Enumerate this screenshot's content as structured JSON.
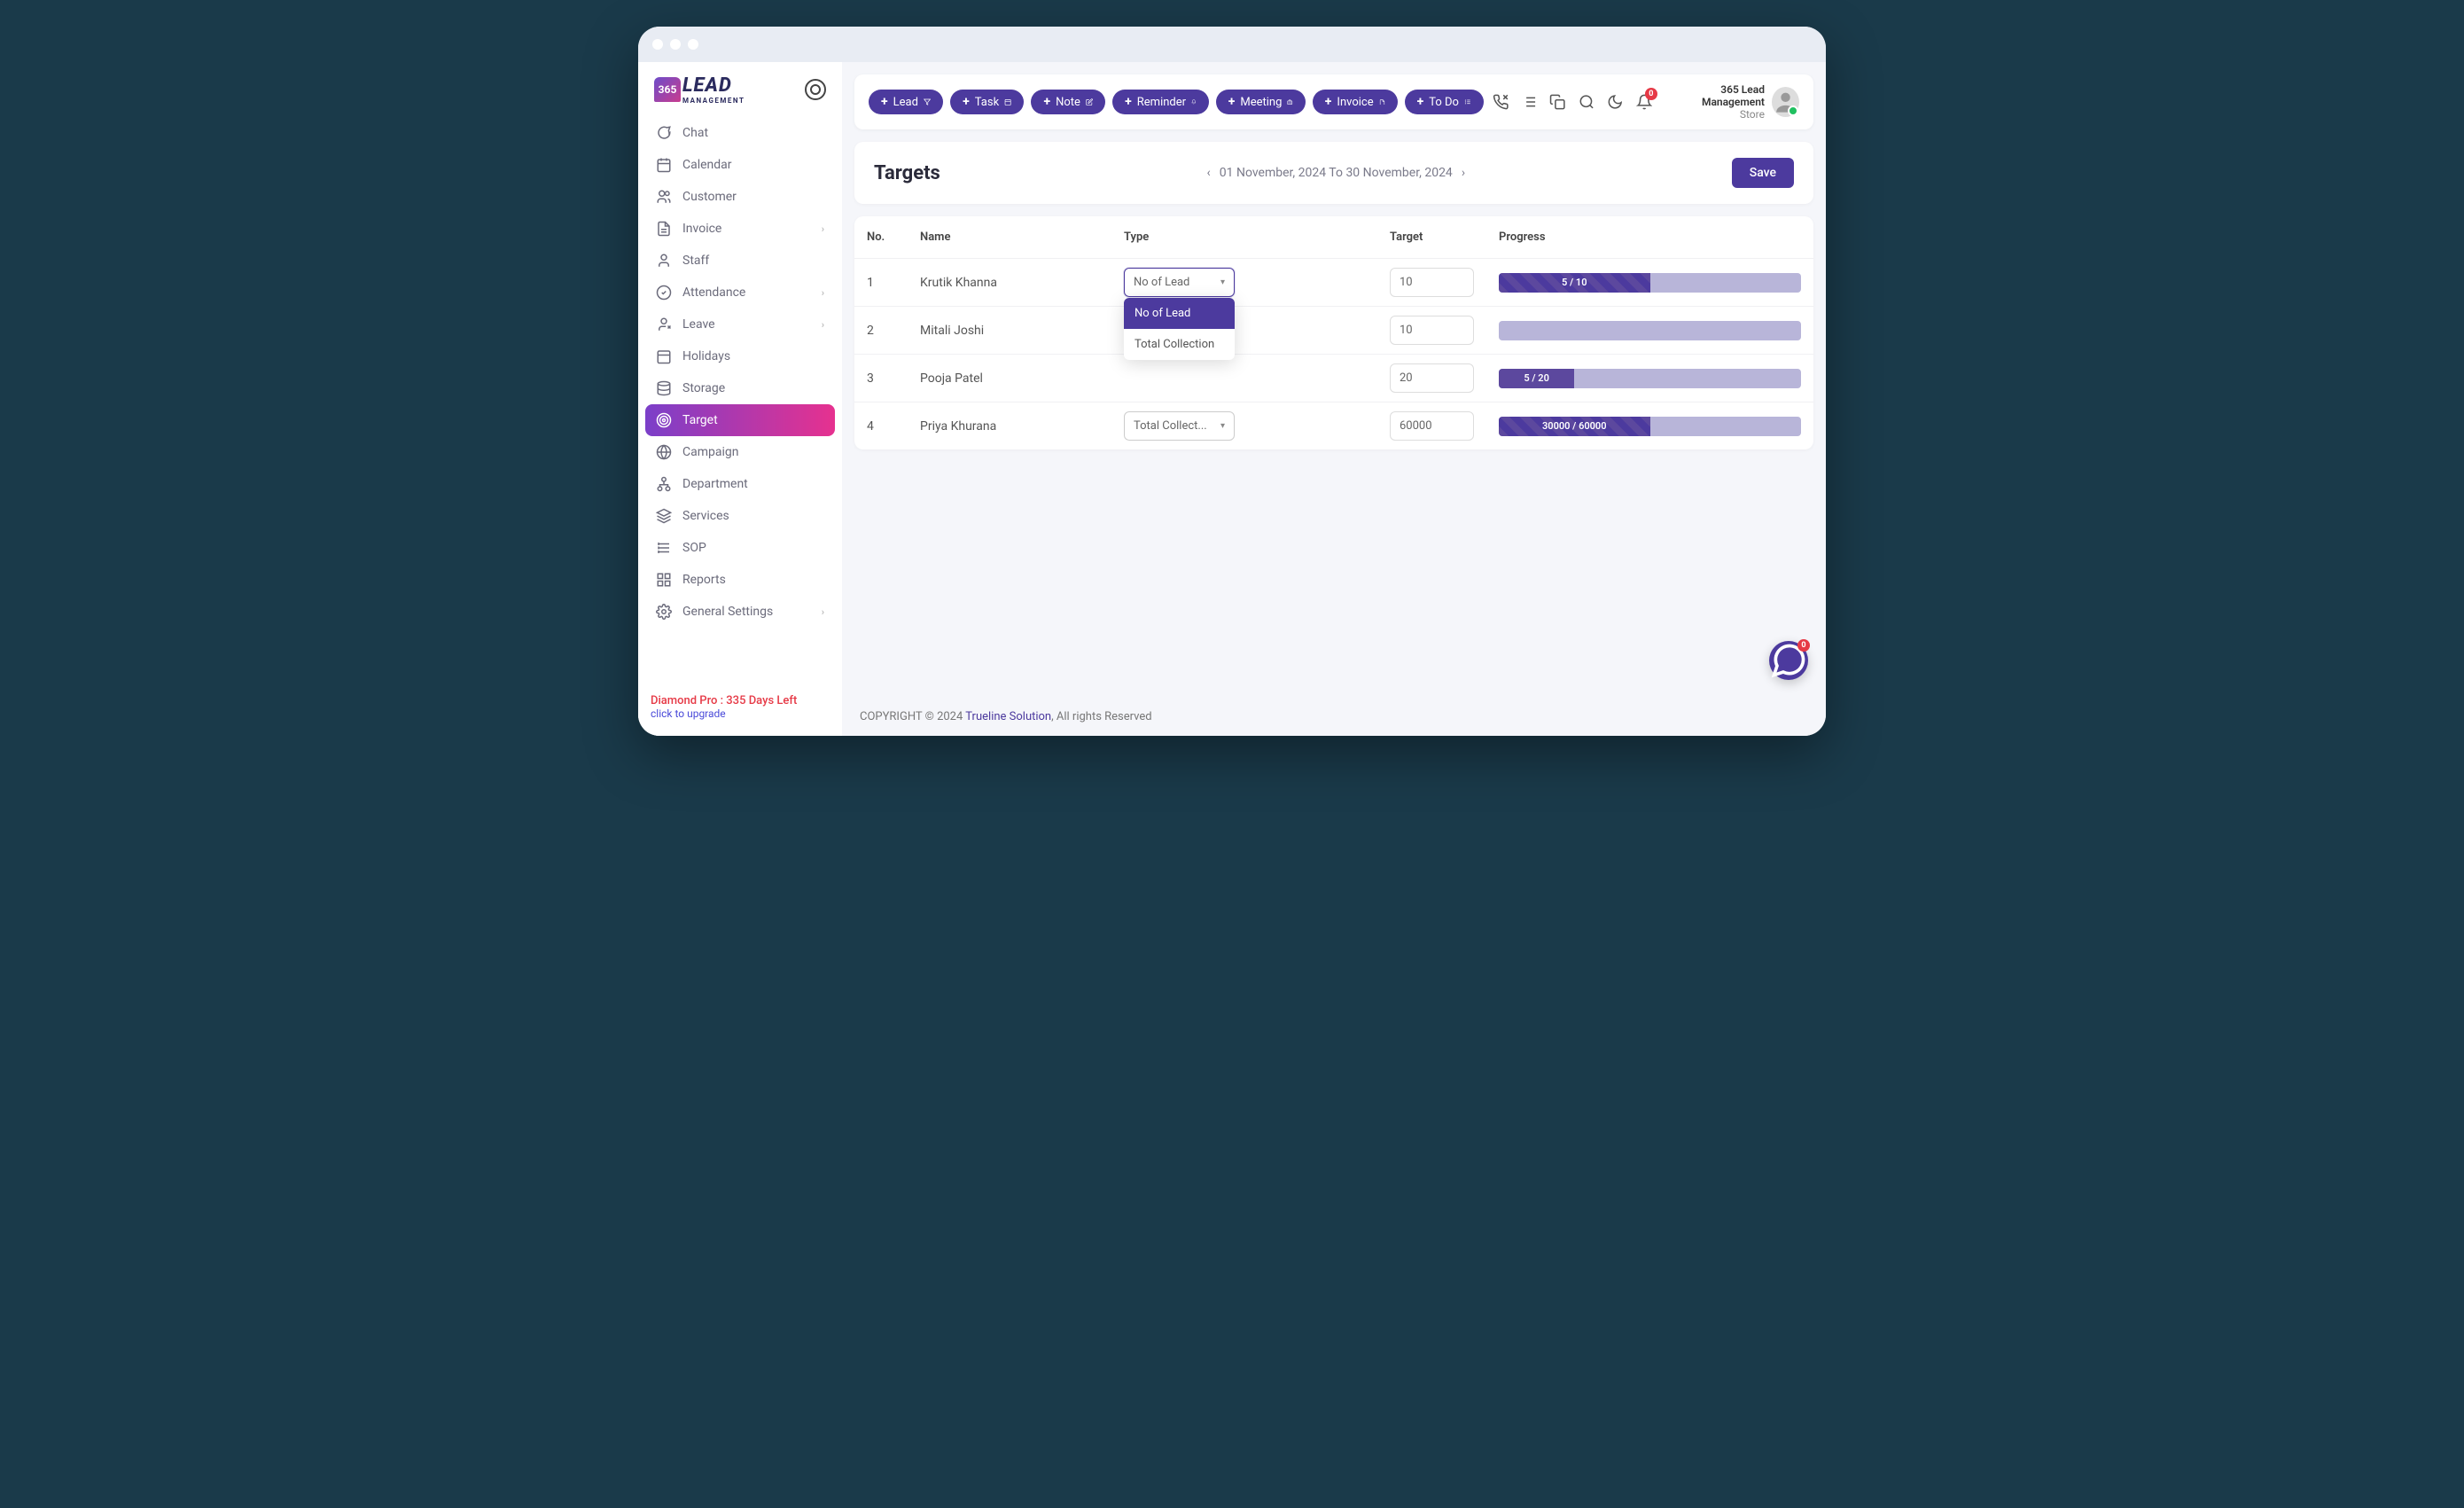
{
  "brand": {
    "name": "LEAD",
    "sub": "MANAGEMENT",
    "mark": "365"
  },
  "sidebar": {
    "items": [
      {
        "label": "Chat",
        "icon": "chat"
      },
      {
        "label": "Calendar",
        "icon": "calendar"
      },
      {
        "label": "Customer",
        "icon": "customer"
      },
      {
        "label": "Invoice",
        "icon": "invoice",
        "expand": true
      },
      {
        "label": "Staff",
        "icon": "staff"
      },
      {
        "label": "Attendance",
        "icon": "attendance",
        "expand": true
      },
      {
        "label": "Leave",
        "icon": "leave",
        "expand": true
      },
      {
        "label": "Holidays",
        "icon": "holidays"
      },
      {
        "label": "Storage",
        "icon": "storage"
      },
      {
        "label": "Target",
        "icon": "target",
        "active": true
      },
      {
        "label": "Campaign",
        "icon": "campaign"
      },
      {
        "label": "Department",
        "icon": "department"
      },
      {
        "label": "Services",
        "icon": "services"
      },
      {
        "label": "SOP",
        "icon": "sop"
      },
      {
        "label": "Reports",
        "icon": "reports"
      },
      {
        "label": "General Settings",
        "icon": "settings",
        "expand": true
      }
    ],
    "plan": "Diamond Pro : 335 Days Left",
    "upgrade": "click to upgrade"
  },
  "toolbar": {
    "buttons": [
      {
        "label": "Lead",
        "icon": "filter"
      },
      {
        "label": "Task",
        "icon": "calendar-small"
      },
      {
        "label": "Note",
        "icon": "edit"
      },
      {
        "label": "Reminder",
        "icon": "bell"
      },
      {
        "label": "Meeting",
        "icon": "briefcase"
      },
      {
        "label": "Invoice",
        "icon": "doc"
      },
      {
        "label": "To Do",
        "icon": "checklist"
      }
    ]
  },
  "header_icons": {
    "bell_count": "0"
  },
  "user": {
    "name": "365 Lead Management",
    "role": "Store"
  },
  "page": {
    "title": "Targets",
    "date_range": "01 November, 2024 To 30 November, 2024",
    "save_label": "Save"
  },
  "table": {
    "headers": {
      "no": "No.",
      "name": "Name",
      "type": "Type",
      "target": "Target",
      "progress": "Progress"
    },
    "type_options": [
      "No of Lead",
      "Total Collection"
    ],
    "rows": [
      {
        "no": "1",
        "name": "Krutik Khanna",
        "type": "No of Lead",
        "target": "10",
        "progress_label": "5 / 10",
        "progress_pct": 50,
        "focused": true,
        "striped": true
      },
      {
        "no": "2",
        "name": "Mitali Joshi",
        "type": "",
        "target": "10",
        "progress_label": "",
        "progress_pct": 0
      },
      {
        "no": "3",
        "name": "Pooja Patel",
        "type": "",
        "target": "20",
        "progress_label": "5 / 20",
        "progress_pct": 25,
        "solid": true
      },
      {
        "no": "4",
        "name": "Priya Khurana",
        "type": "Total Collect...",
        "target": "60000",
        "progress_label": "30000 / 60000",
        "progress_pct": 50,
        "striped": true
      }
    ]
  },
  "footer": {
    "copyright": "COPYRIGHT © 2024 ",
    "link": "Trueline Solution",
    "rest": ", All rights Reserved"
  },
  "chat_fab": {
    "badge": "0"
  }
}
